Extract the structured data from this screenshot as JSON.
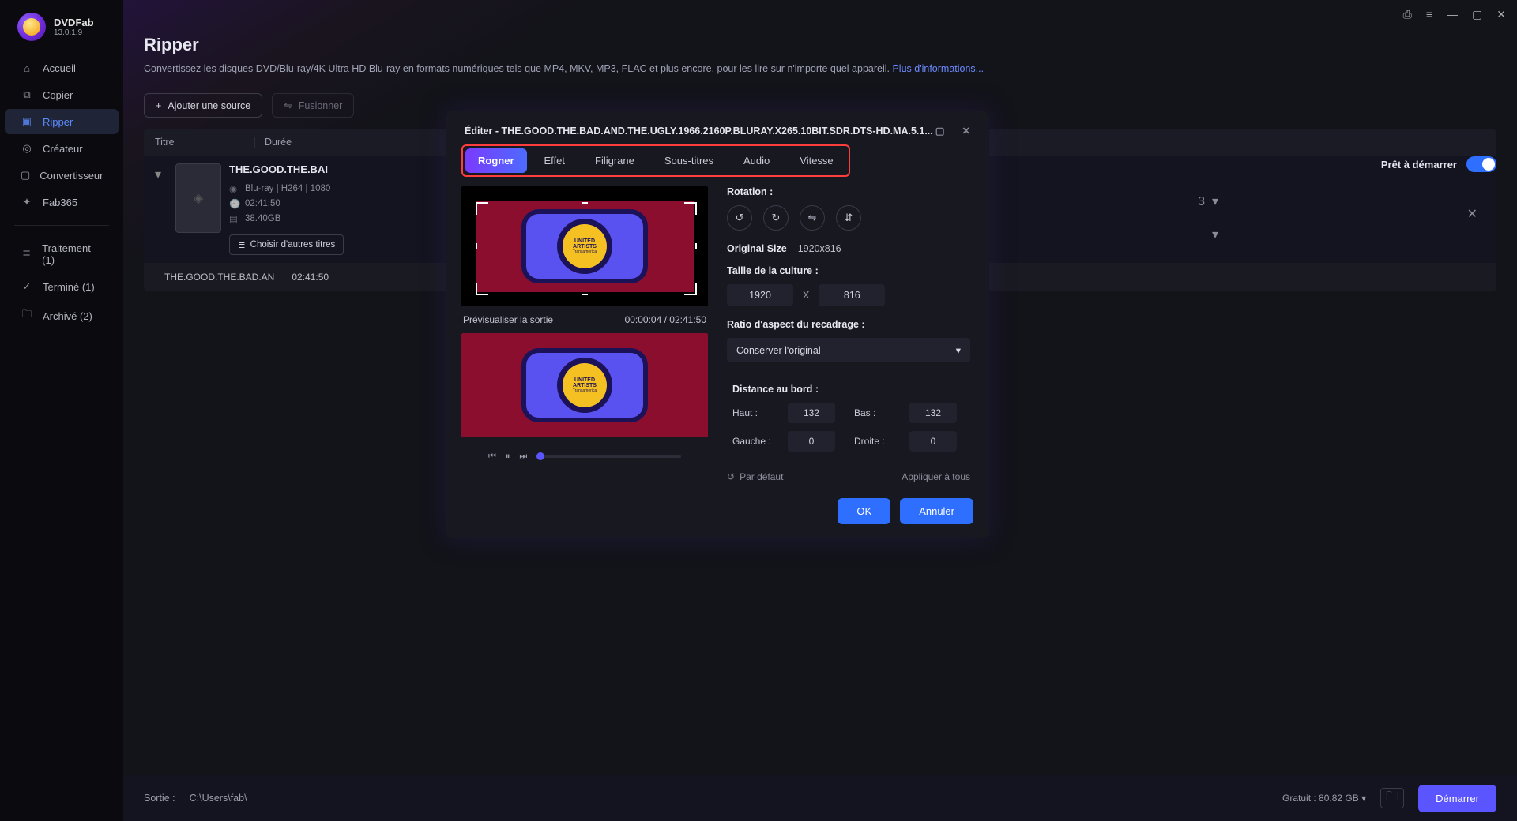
{
  "app": {
    "brand": "DVDFab",
    "version": "13.0.1.9"
  },
  "sidebar": {
    "items": [
      {
        "label": "Accueil"
      },
      {
        "label": "Copier"
      },
      {
        "label": "Ripper"
      },
      {
        "label": "Créateur"
      },
      {
        "label": "Convertisseur"
      },
      {
        "label": "Fab365"
      }
    ],
    "lists": [
      {
        "label": "Traitement (1)"
      },
      {
        "label": "Terminé (1)"
      },
      {
        "label": "Archivé (2)"
      }
    ]
  },
  "page": {
    "title": "Ripper",
    "subtitle": "Convertissez les disques DVD/Blu-ray/4K Ultra HD Blu-ray en formats numériques tels que MP4, MKV, MP3, FLAC et plus encore, pour les lire sur n'importe quel appareil. ",
    "more_link": "Plus d'informations...",
    "add_source": "Ajouter une source",
    "merge": "Fusionner",
    "status": "Prêt à démarrer"
  },
  "table": {
    "col_title": "Titre",
    "col_duration": "Durée"
  },
  "item": {
    "title": "THE.GOOD.THE.BAD.AND.THE.UGLY.1966.2160P.BLURAY.X265.10BIT.SDR.DTS-HD.MA.5.1",
    "title_short": "THE.GOOD.THE.BAI",
    "format": "Blu-ray | H264 | 1080",
    "duration": "02:41:50",
    "size": "38.40GB",
    "other_titles": "Choisir d'autres titres",
    "track_dd": "3",
    "subrow_name": "THE.GOOD.THE.BAD.AN",
    "subrow_dur": "02:41:50"
  },
  "footer": {
    "out_label": "Sortie :",
    "path": "C:\\Users\\fab\\",
    "free": "Gratuit : 80.82 GB ▾",
    "start": "Démarrer"
  },
  "modal": {
    "title": "Éditer - THE.GOOD.THE.BAD.AND.THE.UGLY.1966.2160P.BLURAY.X265.10BIT.SDR.DTS-HD.MA.5.1...",
    "tabs": [
      "Rogner",
      "Effet",
      "Filigrane",
      "Sous-titres",
      "Audio",
      "Vitesse"
    ],
    "preview_label": "Prévisualiser la sortie",
    "preview_time": "00:00:04 / 02:41:50",
    "rotation_label": "Rotation :",
    "orig_size_label": "Original Size",
    "orig_size_val": "1920x816",
    "crop_size_label": "Taille de la culture :",
    "crop_w": "1920",
    "crop_h": "816",
    "aspect_label": "Ratio d'aspect du recadrage :",
    "aspect_val": "Conserver l'original",
    "distance_label": "Distance au bord :",
    "dist": {
      "top_l": "Haut :",
      "top_v": "132",
      "bottom_l": "Bas :",
      "bottom_v": "132",
      "left_l": "Gauche :",
      "left_v": "0",
      "right_l": "Droite :",
      "right_v": "0"
    },
    "reset": "Par défaut",
    "apply_all": "Appliquer à tous",
    "ok": "OK",
    "cancel": "Annuler"
  }
}
